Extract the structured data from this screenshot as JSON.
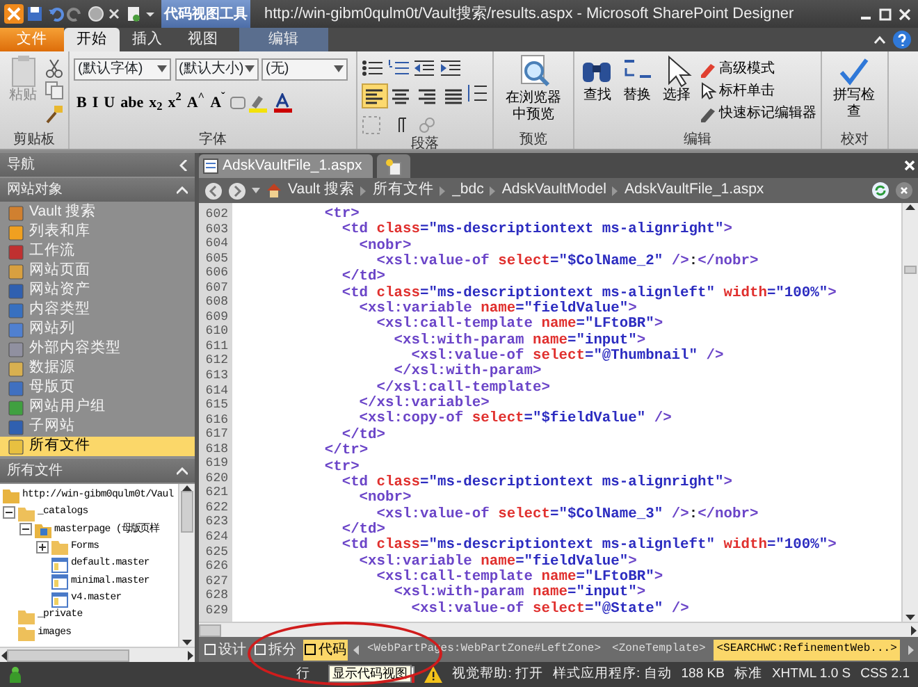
{
  "window": {
    "title": "http://win-gibm0qulm0t/Vault搜索/results.aspx  -  Microsoft SharePoint Designer"
  },
  "contextual_group": {
    "title": "代码视图工具"
  },
  "ribbon_tabs": [
    {
      "label": "文件",
      "kind": "file",
      "selected": false
    },
    {
      "label": "开始",
      "kind": "tab",
      "selected": true
    },
    {
      "label": "插入",
      "kind": "tab",
      "selected": false
    },
    {
      "label": "视图",
      "kind": "tab",
      "selected": false
    },
    {
      "label": "编辑",
      "kind": "contextual",
      "selected": false
    }
  ],
  "ribbon": {
    "clipboard": {
      "label": "剪贴板",
      "paste": "粘贴"
    },
    "font": {
      "label": "字体",
      "font_name": "(默认字体)",
      "font_size": "(默认大小)",
      "style": "(无)",
      "format_buttons": [
        "B",
        "I",
        "U",
        "abe",
        "x$_{2}$",
        "x$^{2}$",
        "A$^{^}$",
        "A$^{ˇ}$"
      ]
    },
    "paragraph": {
      "label": "段落",
      "alignment": [
        {
          "kind": "left",
          "selected": true
        },
        {
          "kind": "center",
          "selected": false
        },
        {
          "kind": "right",
          "selected": false
        },
        {
          "kind": "justify",
          "selected": false
        }
      ]
    },
    "preview": {
      "label": "预览",
      "button": "在浏览器中预览"
    },
    "editing": {
      "label": "编辑",
      "large_buttons": [
        "查找",
        "替换",
        "选择"
      ],
      "small_buttons": [
        "高级模式",
        "标杆单击",
        "快速标记编辑器"
      ]
    },
    "proofing": {
      "label": "校对",
      "button": "拼写检查"
    }
  },
  "navigation": {
    "title": "导航",
    "site_objects": {
      "title": "网站对象",
      "items": [
        {
          "label": "Vault 搜索",
          "selected": false
        },
        {
          "label": "列表和库",
          "selected": false
        },
        {
          "label": "工作流",
          "selected": false
        },
        {
          "label": "网站页面",
          "selected": false
        },
        {
          "label": "网站资产",
          "selected": false
        },
        {
          "label": "内容类型",
          "selected": false
        },
        {
          "label": "网站列",
          "selected": false
        },
        {
          "label": "外部内容类型",
          "selected": false
        },
        {
          "label": "数据源",
          "selected": false
        },
        {
          "label": "母版页",
          "selected": false
        },
        {
          "label": "网站用户组",
          "selected": false
        },
        {
          "label": "子网站",
          "selected": false
        },
        {
          "label": "所有文件",
          "selected": true
        }
      ]
    },
    "all_files": {
      "title": "所有文件",
      "tree": [
        {
          "label": "http://win-gibm0qulm0t/Vaul",
          "kind": "site",
          "children": [
            {
              "label": "_catalogs",
              "kind": "folder",
              "expanded": true,
              "children": [
                {
                  "label": "masterpage (母版页样",
                  "kind": "special",
                  "expanded": true,
                  "children": [
                    {
                      "label": "Forms",
                      "kind": "folder",
                      "expanded": false
                    },
                    {
                      "label": "default.master",
                      "kind": "file"
                    },
                    {
                      "label": "minimal.master",
                      "kind": "file"
                    },
                    {
                      "label": "v4.master",
                      "kind": "file"
                    }
                  ]
                }
              ]
            },
            {
              "label": "_private",
              "kind": "folder"
            },
            {
              "label": "images",
              "kind": "folder"
            }
          ]
        }
      ]
    }
  },
  "editor": {
    "tabs": [
      {
        "label": "AdskVaultFile_1.aspx",
        "selected": true
      }
    ],
    "breadcrumb": [
      "Vault 搜索",
      "所有文件",
      "_bdc",
      "AdskVaultModel",
      "AdskVaultFile_1.aspx"
    ],
    "line_numbers": [
      "602",
      "603",
      "604",
      "605",
      "606",
      "607",
      "608",
      "609",
      "610",
      "611",
      "612",
      "613",
      "614",
      "615",
      "616",
      "617",
      "618",
      "619",
      "620",
      "621",
      "622",
      "623",
      "624",
      "625",
      "626",
      "627",
      "628",
      "629"
    ],
    "code_lines": [
      "          <tr>",
      "            <td class=\"ms-descriptiontext ms-alignright\">",
      "              <nobr>",
      "                <xsl:value-of select=\"$ColName_2\" />:</nobr>",
      "            </td>",
      "            <td class=\"ms-descriptiontext ms-alignleft\" width=\"100%\">",
      "              <xsl:variable name=\"fieldValue\">",
      "                <xsl:call-template name=\"LFtoBR\">",
      "                  <xsl:with-param name=\"input\">",
      "                    <xsl:value-of select=\"@Thumbnail\" />",
      "                  </xsl:with-param>",
      "                </xsl:call-template>",
      "              </xsl:variable>",
      "              <xsl:copy-of select=\"$fieldValue\" />",
      "            </td>",
      "          </tr>",
      "          <tr>",
      "            <td class=\"ms-descriptiontext ms-alignright\">",
      "              <nobr>",
      "                <xsl:value-of select=\"$ColName_3\" />:</nobr>",
      "            </td>",
      "            <td class=\"ms-descriptiontext ms-alignleft\" width=\"100%\">",
      "              <xsl:variable name=\"fieldValue\">",
      "                <xsl:call-template name=\"LFtoBR\">",
      "                  <xsl:with-param name=\"input\">",
      "                    <xsl:value-of select=\"@State\" />"
    ],
    "view_modes": [
      {
        "label": "设计",
        "selected": false
      },
      {
        "label": "拆分",
        "selected": false
      },
      {
        "label": "代码",
        "selected": true
      }
    ],
    "tag_path": [
      {
        "label": "<WebPartPages:WebPartZone#LeftZone>",
        "selected": false
      },
      {
        "label": "<ZoneTemplate>",
        "selected": false
      },
      {
        "label": "<SEARCHWC:RefinementWeb...>",
        "selected": true
      }
    ]
  },
  "tooltip": "显示代码视图",
  "status_bar": {
    "line": "行",
    "items": [
      "视觉帮助: 打开",
      "样式应用程序: 自动",
      "188 KB",
      "标准",
      "XHTML 1.0 S",
      "CSS 2.1"
    ]
  }
}
